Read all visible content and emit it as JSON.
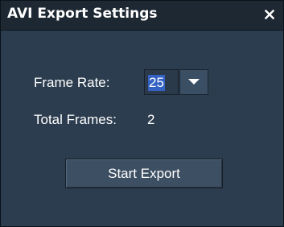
{
  "window": {
    "title": "AVI Export Settings",
    "close_icon": "close-icon",
    "close_glyph": "×"
  },
  "frame_rate": {
    "label": "Frame Rate:",
    "selected_value": "25",
    "dropdown_icon": "chevron-down-icon"
  },
  "total_frames": {
    "label": "Total Frames:",
    "value": "2"
  },
  "actions": {
    "start_export_label": "Start Export"
  }
}
